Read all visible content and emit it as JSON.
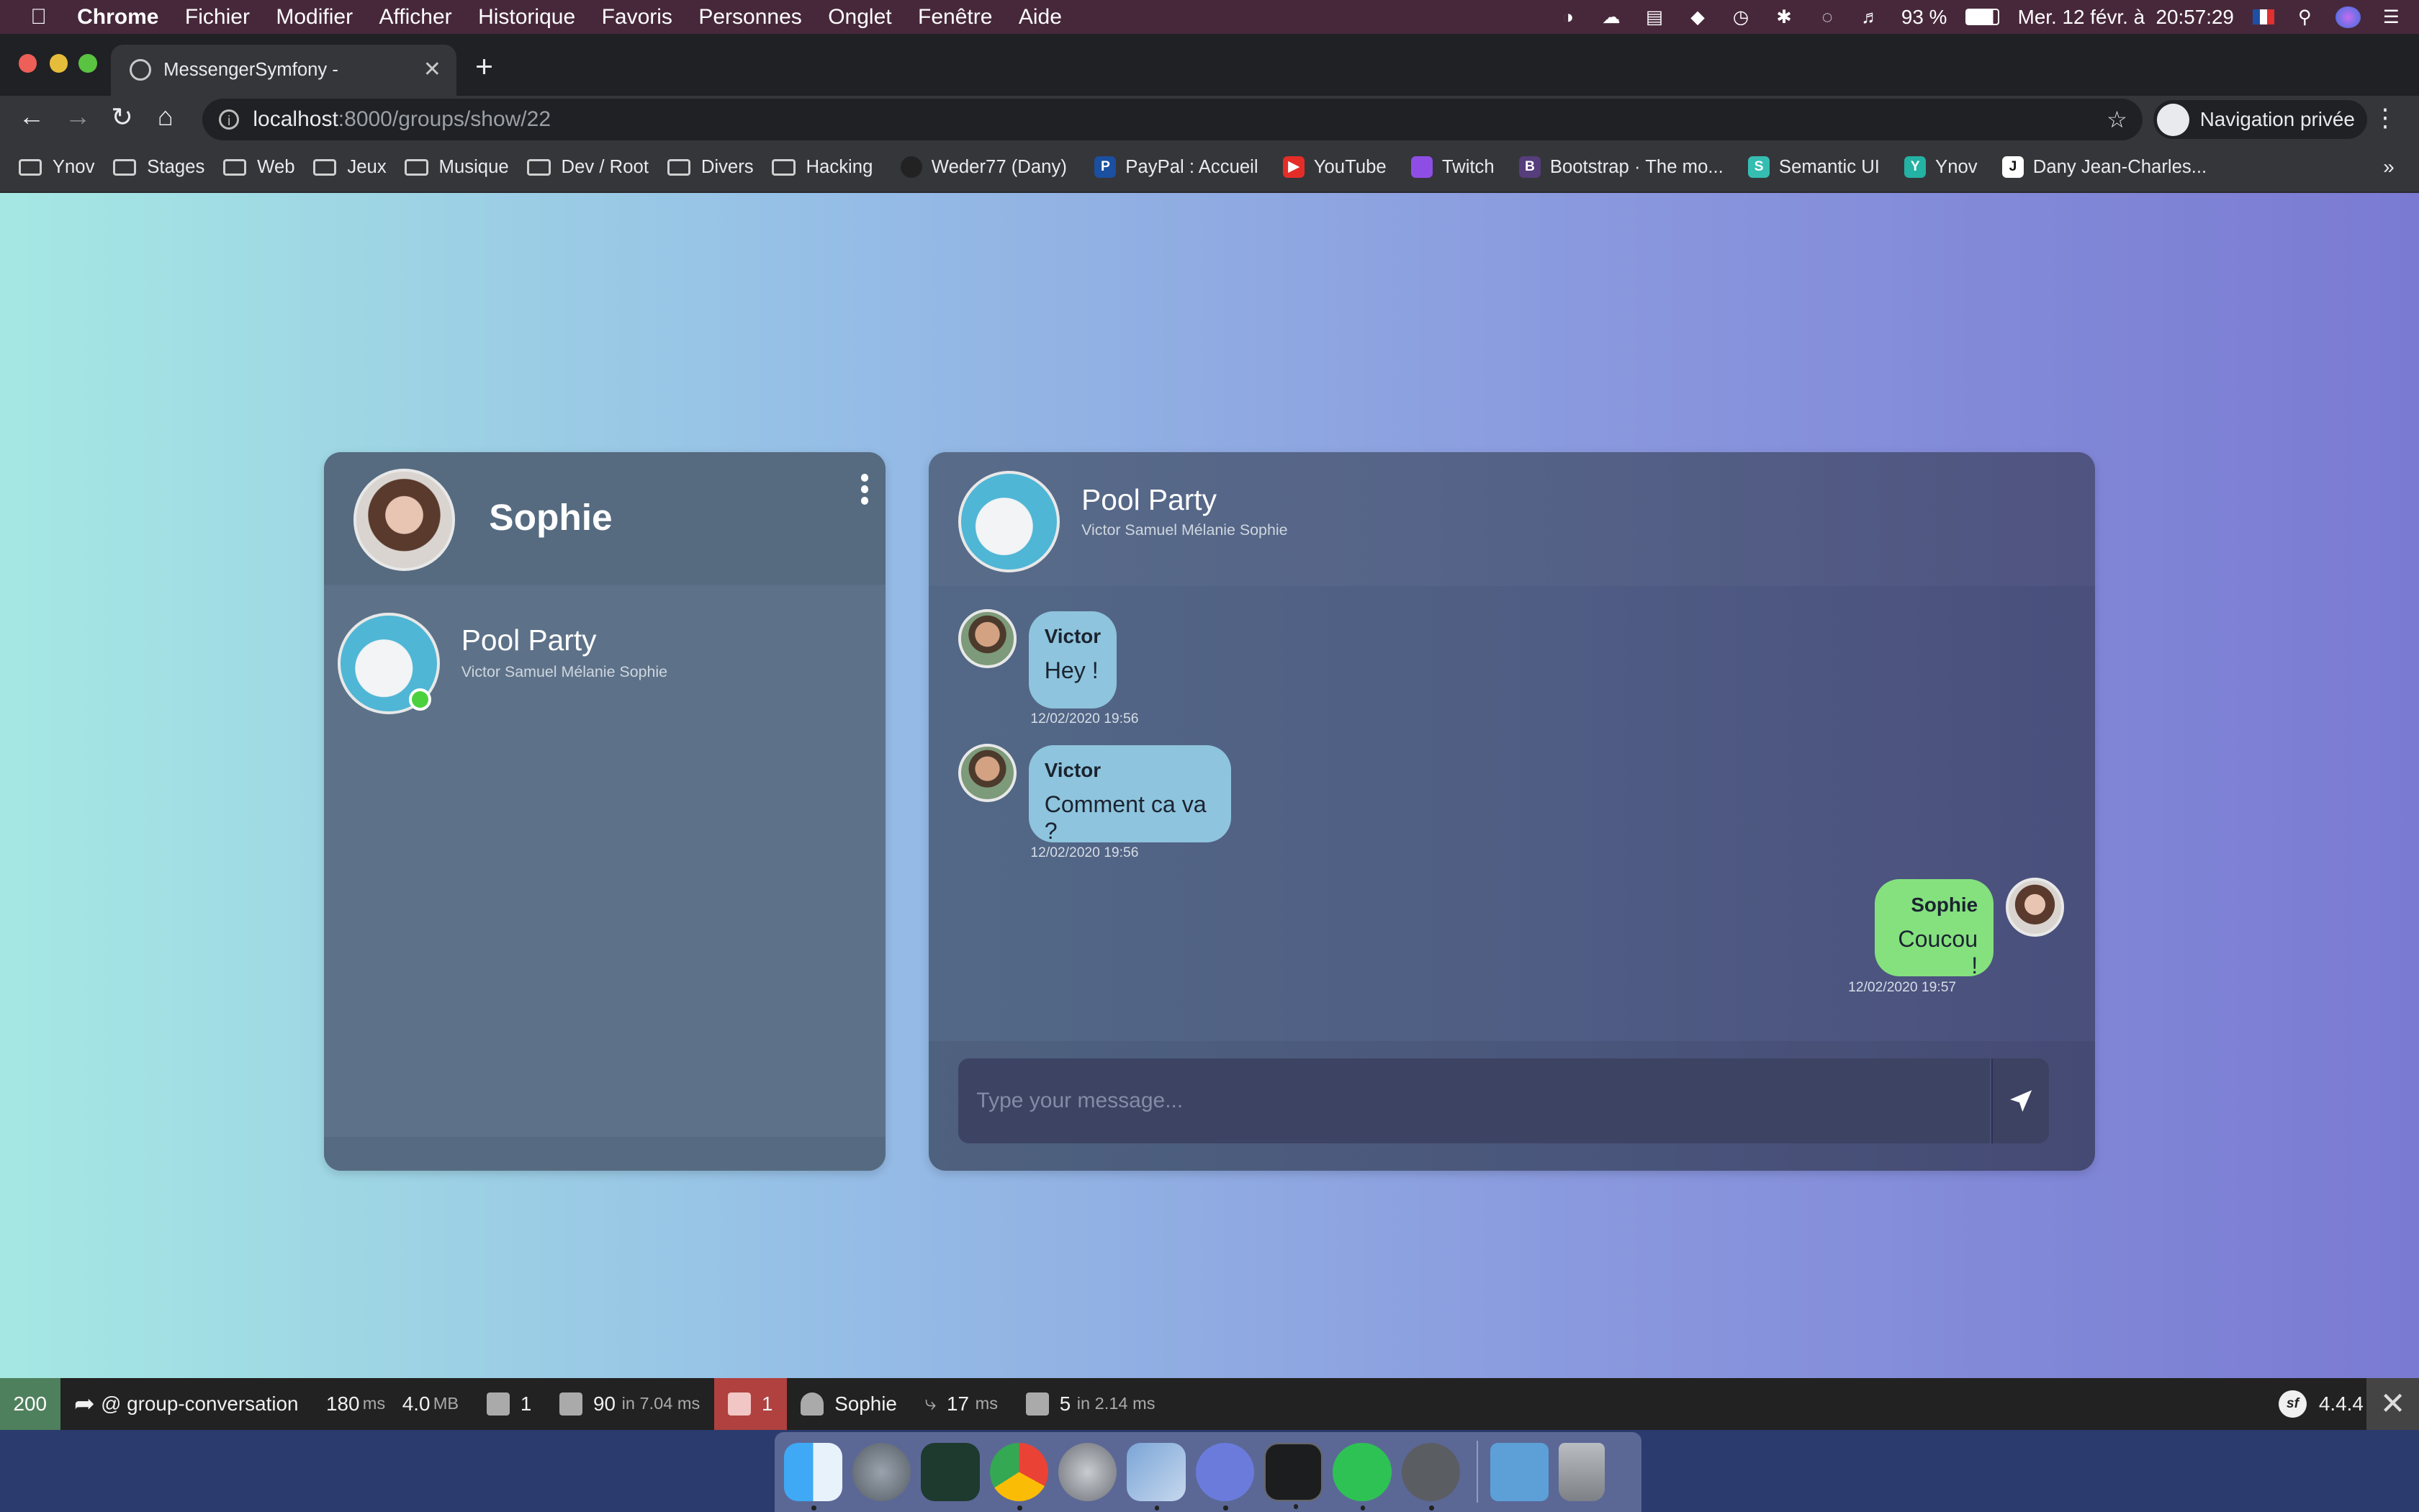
{
  "menubar": {
    "items": [
      "Chrome",
      "Fichier",
      "Modifier",
      "Afficher",
      "Historique",
      "Favoris",
      "Personnes",
      "Onglet",
      "Fenêtre",
      "Aide"
    ],
    "battery": "93 %",
    "datetime": "Mer. 12 févr. à  20:57:29"
  },
  "browser": {
    "tab_title": "MessengerSymfony -",
    "url_host": "localhost",
    "url_path": ":8000/groups/show/22",
    "incognito_label": "Navigation privée",
    "bookmarks": [
      {
        "label": "Ynov",
        "icon": "folder-icon"
      },
      {
        "label": "Stages",
        "icon": "folder-icon"
      },
      {
        "label": "Web",
        "icon": "folder-icon"
      },
      {
        "label": "Jeux",
        "icon": "folder-icon"
      },
      {
        "label": "Musique",
        "icon": "folder-icon"
      },
      {
        "label": "Dev / Root",
        "icon": "folder-icon"
      },
      {
        "label": "Divers",
        "icon": "folder-icon"
      },
      {
        "label": "Hacking",
        "icon": "folder-icon"
      },
      {
        "label": "Weder77 (Dany)",
        "icon": "github-icon"
      },
      {
        "label": "PayPal : Accueil",
        "icon": "paypal-icon"
      },
      {
        "label": "YouTube",
        "icon": "youtube-icon"
      },
      {
        "label": "Twitch",
        "icon": "twitch-icon"
      },
      {
        "label": "Bootstrap · The mo...",
        "icon": "bootstrap-icon"
      },
      {
        "label": "Semantic UI",
        "icon": "semantic-ui-icon"
      },
      {
        "label": "Ynov",
        "icon": "ynov-icon"
      },
      {
        "label": "Dany Jean-Charles...",
        "icon": "profile-icon"
      }
    ],
    "more_bookmarks": "»"
  },
  "sidebar": {
    "user_name": "Sophie",
    "conversations": [
      {
        "title": "Pool Party",
        "members": "Victor Samuel Mélanie Sophie",
        "online": true
      }
    ]
  },
  "chat": {
    "title": "Pool Party",
    "members": "Victor Samuel Mélanie Sophie",
    "messages": [
      {
        "author": "Victor",
        "text": "Hey !",
        "time": "12/02/2020 19:56",
        "direction": "incoming"
      },
      {
        "author": "Victor",
        "text": "Comment ca va ?",
        "time": "12/02/2020 19:56",
        "direction": "incoming"
      },
      {
        "author": "Sophie",
        "text": "Coucou !",
        "time": "12/02/2020 19:57",
        "direction": "outgoing"
      }
    ],
    "input_placeholder": "Type your message..."
  },
  "debug_toolbar": {
    "status": "200",
    "route": "@ group-conversation",
    "time_value": "180",
    "time_unit": "ms",
    "memory_value": "4.0",
    "memory_unit": "MB",
    "forms": "1",
    "twig_value": "90",
    "twig_unit": "in 7.04 ms",
    "logs": "1",
    "user": "Sophie",
    "events_value": "17",
    "events_unit": "ms",
    "db_value": "5",
    "db_unit": "in 2.14 ms",
    "version": "4.4.4"
  },
  "colors": {
    "incoming_bubble": "#8ec4dd",
    "outgoing_bubble": "#84e17e",
    "online_indicator": "#4cd13e",
    "status_ok": "#4f805d",
    "log_alert": "#b0413e"
  }
}
